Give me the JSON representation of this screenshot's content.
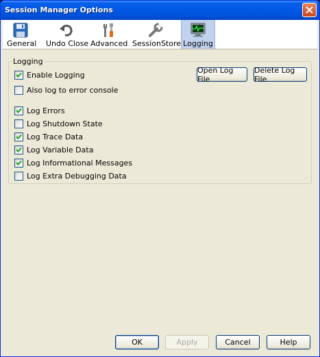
{
  "window": {
    "title": "Session Manager Options"
  },
  "toolbar": {
    "items": [
      {
        "label": "General",
        "icon": "floppy-disk-icon"
      },
      {
        "label": "Undo Close",
        "icon": "undo-arrow-icon"
      },
      {
        "label": "Advanced",
        "icon": "tools-icon"
      },
      {
        "label": "SessionStore",
        "icon": "wrench-icon"
      },
      {
        "label": "Logging",
        "icon": "monitor-icon",
        "active": true
      }
    ]
  },
  "logging": {
    "group_label": "Logging",
    "enable_logging": {
      "label": "Enable Logging",
      "checked": true
    },
    "error_console": {
      "label": "Also log to error console",
      "checked": false
    },
    "open_log_file": "Open Log File",
    "delete_log_file": "Delete Log File",
    "options": [
      {
        "label": "Log Errors",
        "checked": true
      },
      {
        "label": "Log Shutdown State",
        "checked": false
      },
      {
        "label": "Log Trace Data",
        "checked": true
      },
      {
        "label": "Log Variable Data",
        "checked": true
      },
      {
        "label": "Log Informational Messages",
        "checked": true
      },
      {
        "label": "Log Extra Debugging Data",
        "checked": false
      }
    ]
  },
  "buttons": {
    "ok": "OK",
    "apply": "Apply",
    "cancel": "Cancel",
    "help": "Help"
  },
  "colors": {
    "titlebar": "#0058e6",
    "dialog_bg": "#ece9d8",
    "check": "#21a121"
  }
}
